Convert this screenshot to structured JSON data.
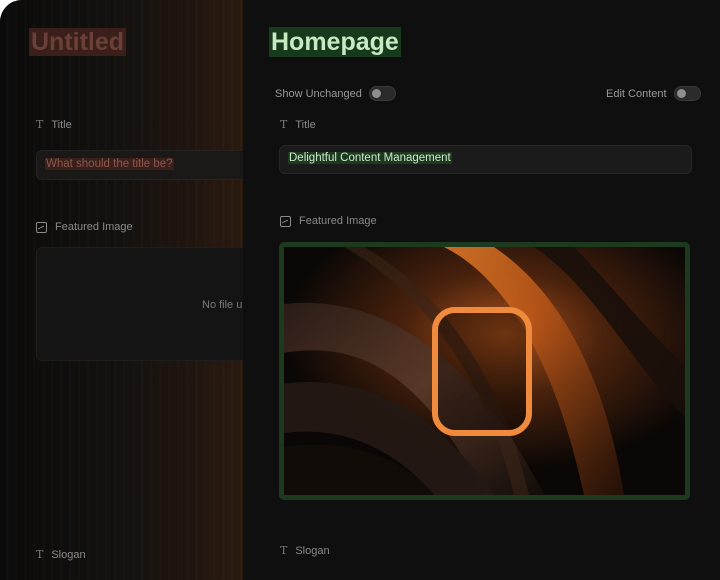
{
  "left": {
    "title": "Untitled",
    "fields": {
      "title_label": "Title",
      "title_placeholder": "What should the title be?",
      "featured_image_label": "Featured Image",
      "upload_text": "No file u",
      "slogan_label": "Slogan"
    }
  },
  "right": {
    "title": "Homepage",
    "show_unchanged_label": "Show Unchanged",
    "edit_content_label": "Edit Content",
    "fields": {
      "title_label": "Title",
      "title_value": "Delightful Content Management",
      "featured_image_label": "Featured Image",
      "slogan_label": "Slogan"
    }
  },
  "icons": {
    "text_field": "text-icon",
    "image_field": "image-icon",
    "toggle": "toggle-switch"
  },
  "colors": {
    "removed_bg": "#3a1f1a",
    "added_bg": "#173a1d",
    "accent_orange": "#f08a3c"
  }
}
